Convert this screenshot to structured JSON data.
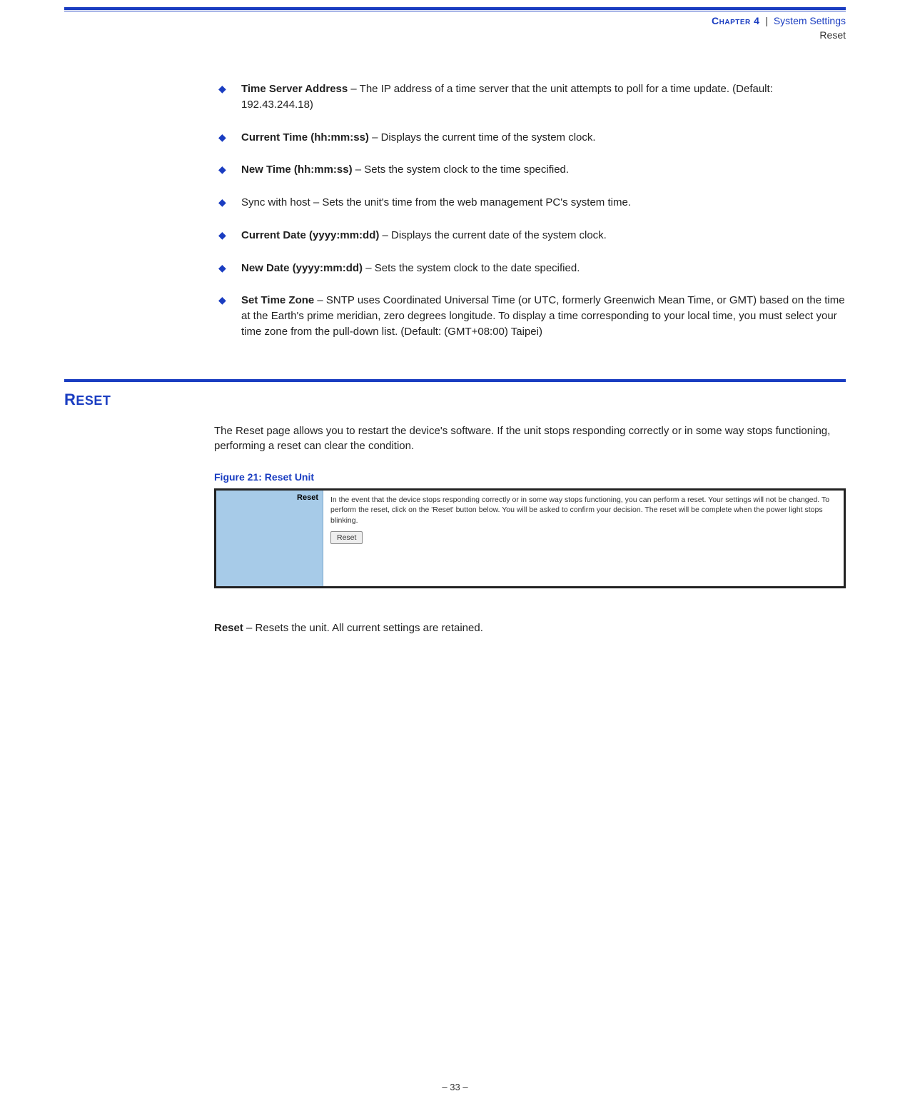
{
  "header": {
    "chapter_small": "Chapter 4",
    "pipe": "|",
    "chapter_title": "System Settings",
    "sub": "Reset"
  },
  "bullets": [
    {
      "term": "Time Server Address",
      "desc": " – The IP address of a time server that the unit attempts to poll for a time update. (Default: 192.43.244.18)"
    },
    {
      "term": "Current Time (hh:mm:ss)",
      "desc": " – Displays the current time of the system clock."
    },
    {
      "term": "New Time (hh:mm:ss)",
      "desc": " – Sets the system clock to the time specified."
    },
    {
      "term": "",
      "desc": "Sync with host – Sets the unit's time from the web management PC's system time."
    },
    {
      "term": "Current Date (yyyy:mm:dd)",
      "desc": " – Displays the current date of the system clock."
    },
    {
      "term": "New Date (yyyy:mm:dd)",
      "desc": " – Sets the system clock to the date specified."
    },
    {
      "term": "Set Time Zone",
      "desc": " – SNTP uses Coordinated Universal Time (or UTC, formerly Greenwich Mean Time, or GMT) based on the time at the Earth's prime meridian, zero degrees longitude. To display a time corresponding to your local time, you must select your time zone from the pull-down list. (Default: (GMT+08:00) Taipei)"
    }
  ],
  "section": {
    "heading_big": "R",
    "heading_rest": "ESET",
    "intro": "The Reset page allows you to restart the device's software. If the unit stops responding correctly or in some way stops functioning, performing a reset can clear the condition.",
    "figure_caption": "Figure 21:  Reset Unit",
    "figure_sidebar": "Reset",
    "figure_text": "In the event that the device stops responding correctly or in some way stops functioning, you can perform a reset. Your settings will not be changed. To perform the reset, click on the 'Reset' button below. You will be asked to confirm your decision. The reset will be complete when the power light stops blinking.",
    "figure_button": "Reset",
    "post_term": "Reset",
    "post_desc": " – Resets the unit. All current settings are retained."
  },
  "footer": "–  33  –"
}
